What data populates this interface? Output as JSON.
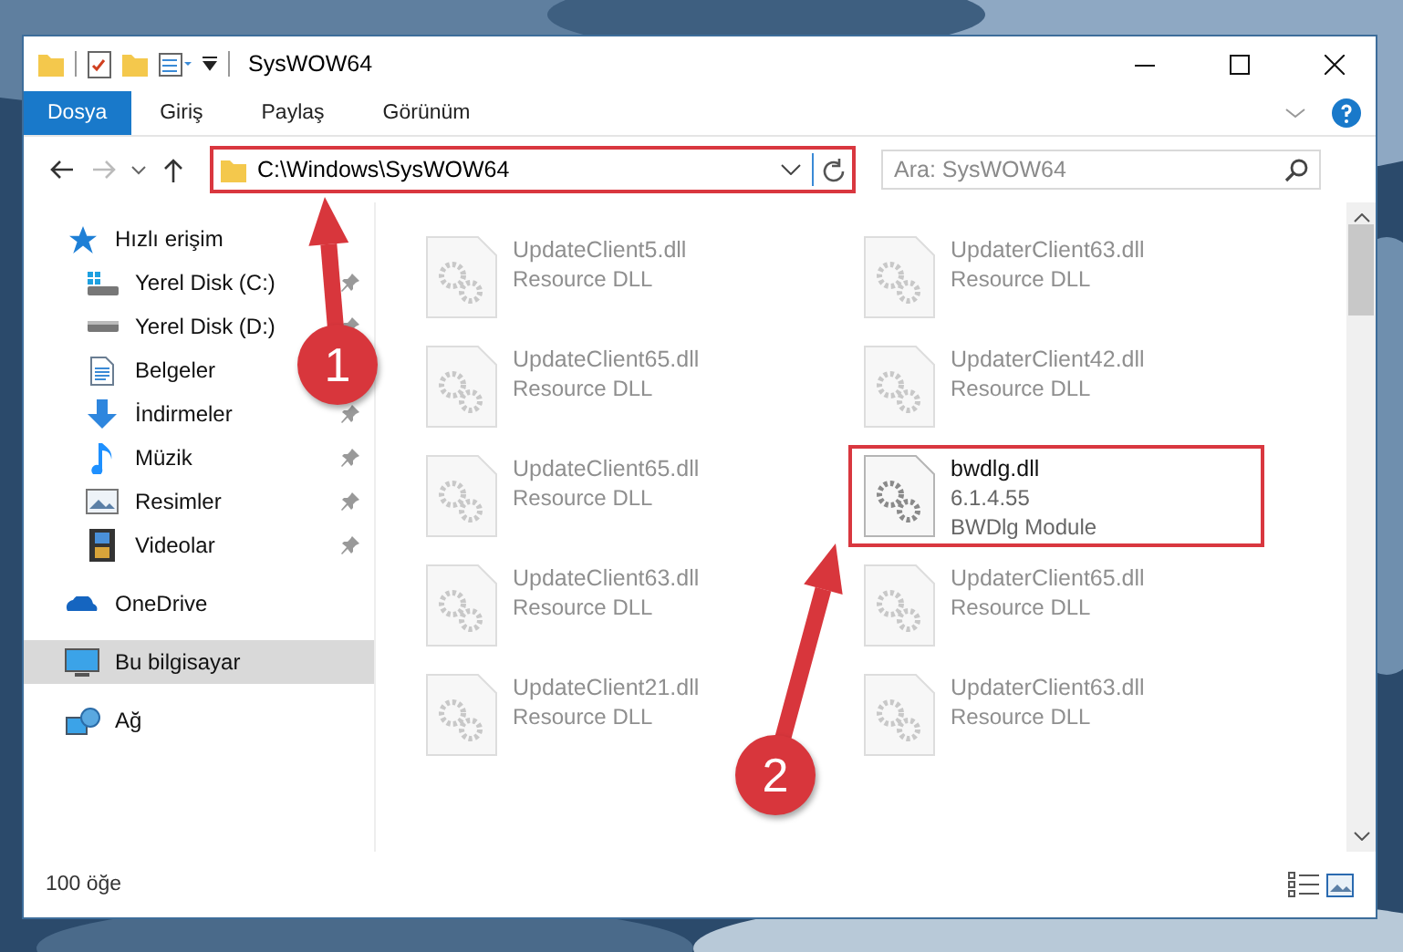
{
  "window": {
    "title": "SysWOW64"
  },
  "ribbon_tabs": [
    {
      "label": "Dosya",
      "selected": true
    },
    {
      "label": "Giriş",
      "selected": false
    },
    {
      "label": "Paylaş",
      "selected": false
    },
    {
      "label": "Görünüm",
      "selected": false
    }
  ],
  "address_bar": {
    "path": "C:\\Windows\\SysWOW64",
    "highlighted": true
  },
  "search": {
    "placeholder": "Ara: SysWOW64"
  },
  "sidebar": {
    "items": [
      {
        "label": "Hızlı erişim",
        "selected": false,
        "children": [
          {
            "label": "Yerel Disk (C:)",
            "pinned": true
          },
          {
            "label": "Yerel Disk (D:)",
            "pinned": true
          },
          {
            "label": "Belgeler",
            "pinned": false
          },
          {
            "label": "İndirmeler",
            "pinned": true
          },
          {
            "label": "Müzik",
            "pinned": true
          },
          {
            "label": "Resimler",
            "pinned": true
          },
          {
            "label": "Videolar",
            "pinned": true
          }
        ]
      },
      {
        "label": "OneDrive",
        "selected": false
      },
      {
        "label": "Bu bilgisayar",
        "selected": true
      },
      {
        "label": "Ağ",
        "selected": false
      }
    ]
  },
  "files": [
    {
      "name": "UpdateClient5.dll",
      "lines": [
        "Resource DLL"
      ],
      "dimmed": true,
      "highlighted": false
    },
    {
      "name": "UpdaterClient63.dll",
      "lines": [
        "Resource DLL"
      ],
      "dimmed": true,
      "highlighted": false
    },
    {
      "name": "UpdateClient65.dll",
      "lines": [
        "Resource DLL"
      ],
      "dimmed": true,
      "highlighted": false
    },
    {
      "name": "UpdaterClient42.dll",
      "lines": [
        "Resource DLL"
      ],
      "dimmed": true,
      "highlighted": false
    },
    {
      "name": "UpdateClient65.dll",
      "lines": [
        "Resource DLL"
      ],
      "dimmed": true,
      "highlighted": false
    },
    {
      "name": "bwdlg.dll",
      "lines": [
        "6.1.4.55",
        "BWDlg Module"
      ],
      "dimmed": false,
      "highlighted": true
    },
    {
      "name": "UpdateClient63.dll",
      "lines": [
        "Resource DLL"
      ],
      "dimmed": true,
      "highlighted": false
    },
    {
      "name": "UpdaterClient65.dll",
      "lines": [
        "Resource DLL"
      ],
      "dimmed": true,
      "highlighted": false
    },
    {
      "name": "UpdateClient21.dll",
      "lines": [
        "Resource DLL"
      ],
      "dimmed": true,
      "highlighted": false
    },
    {
      "name": "UpdaterClient63.dll",
      "lines": [
        "Resource DLL"
      ],
      "dimmed": true,
      "highlighted": false
    }
  ],
  "status_bar": {
    "count": "100 öğe"
  },
  "annotations": [
    {
      "label": "1"
    },
    {
      "label": "2"
    }
  ]
}
